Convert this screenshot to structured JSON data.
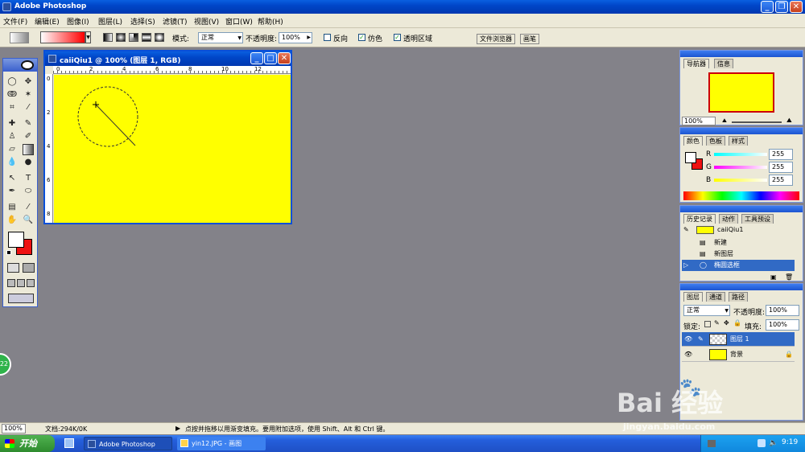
{
  "app": {
    "title": "Adobe Photoshop"
  },
  "menu": [
    "文件(F)",
    "编辑(E)",
    "图像(I)",
    "图层(L)",
    "选择(S)",
    "滤镜(T)",
    "视图(V)",
    "窗口(W)",
    "帮助(H)"
  ],
  "options": {
    "mode_label": "模式:",
    "mode_value": "正常",
    "opacity_label": "不透明度:",
    "opacity_value": "100%",
    "reverse_label": "反向",
    "dither_label": "仿色",
    "transparency_label": "透明区域",
    "file_browser_tab": "文件浏览器",
    "brush_tab": "画笔"
  },
  "document": {
    "title": "caiiQiu1 @ 100% (图层 1, RGB)",
    "canvas_color": "#ffff00",
    "ruler_h": [
      "0",
      "2",
      "4",
      "6",
      "8",
      "10",
      "12"
    ],
    "ruler_v": [
      "0",
      "2",
      "4",
      "6",
      "8"
    ]
  },
  "navigator": {
    "tabs": [
      "导航器",
      "信息"
    ],
    "zoom": "100%"
  },
  "color": {
    "tabs": [
      "颜色",
      "色板",
      "样式"
    ],
    "r_label": "R",
    "r_value": "255",
    "g_label": "G",
    "g_value": "255",
    "b_label": "B",
    "b_value": "255"
  },
  "history": {
    "tabs": [
      "历史记录",
      "动作",
      "工具预设"
    ],
    "snapshot": "caiiQiu1",
    "items": [
      "新建",
      "新图层",
      "椭圆选框"
    ]
  },
  "layers": {
    "tabs": [
      "图层",
      "通道",
      "路径"
    ],
    "blend_mode": "正常",
    "opacity_label": "不透明度:",
    "opacity_value": "100%",
    "lock_label": "锁定:",
    "fill_label": "填充:",
    "fill_value": "100%",
    "items": [
      "图层 1",
      "背景"
    ]
  },
  "status": {
    "zoom": "100%",
    "doc_size": "文档:294K/0K",
    "hint": "点按并拖移以用渐变填充。要用附加选项，使用 Shift、Alt 和 Ctrl 键。"
  },
  "taskbar": {
    "start": "开始",
    "tasks": [
      "Adobe Photoshop",
      "yin12.JPG - 画图"
    ],
    "clock": "9:19"
  },
  "watermark": {
    "brand": "Bai 经验",
    "url": "jingyan.baidu.com"
  },
  "badge": "22",
  "colors": {
    "foreground": "#ffffff",
    "background": "#ee1111",
    "accent": "#316ac5"
  }
}
